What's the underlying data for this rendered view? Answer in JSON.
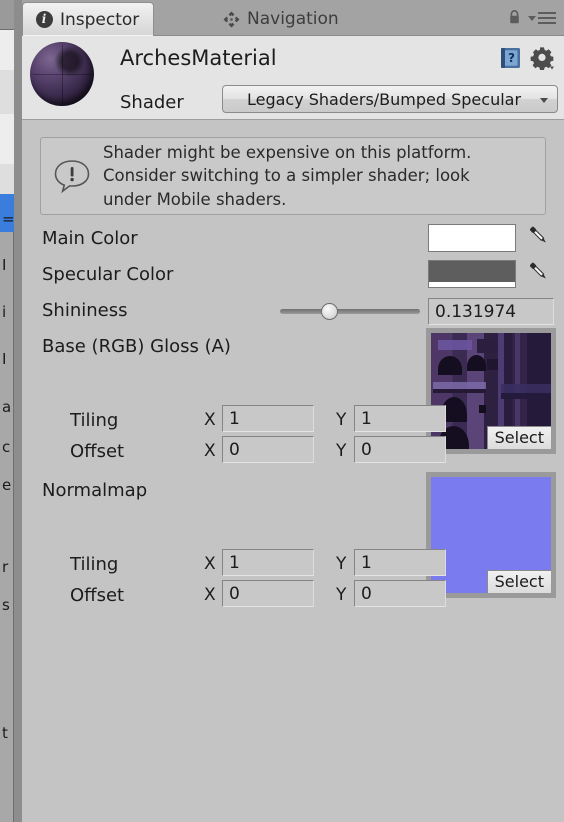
{
  "window": {
    "tabs": [
      {
        "label": "Inspector",
        "icon": "info-circle-icon",
        "active": true
      },
      {
        "label": "Navigation",
        "icon": "move-arrows-icon",
        "active": false
      }
    ],
    "lock_icon": "lock-icon",
    "menu_icon": "hamburger-menu-icon"
  },
  "material": {
    "name": "ArchesMaterial",
    "preview_icon": "material-sphere-preview",
    "shader_label": "Shader",
    "shader_value": "Legacy Shaders/Bumped Specular",
    "help_icon": "help-book-icon",
    "gear_icon": "gear-icon"
  },
  "warning": {
    "icon": "warning-exclamation-icon",
    "text": "Shader might be expensive on this platform.\nConsider switching to a simpler shader; look\nunder Mobile shaders."
  },
  "properties": {
    "main_color": {
      "label": "Main Color",
      "value": "#FFFFFF",
      "alpha": "#FFFFFF",
      "picker_icon": "eyedropper-icon"
    },
    "specular_color": {
      "label": "Specular Color",
      "value": "#5E5E5E",
      "alpha": "#FFFFFF",
      "picker_icon": "eyedropper-icon"
    },
    "shininess": {
      "label": "Shininess",
      "value": "0.131974",
      "slider_percent": 35
    }
  },
  "textures": [
    {
      "label": "Base (RGB) Gloss (A)",
      "preview_kind": "arches-texture",
      "select_label": "Select",
      "tiling": {
        "label": "Tiling",
        "x_label": "X",
        "x": "1",
        "y_label": "Y",
        "y": "1"
      },
      "offset": {
        "label": "Offset",
        "x_label": "X",
        "x": "0",
        "y_label": "Y",
        "y": "0"
      }
    },
    {
      "label": "Normalmap",
      "preview_kind": "normalmap-texture",
      "preview_color": "#7B7BF0",
      "select_label": "Select",
      "tiling": {
        "label": "Tiling",
        "x_label": "X",
        "x": "1",
        "y_label": "Y",
        "y": "1"
      },
      "offset": {
        "label": "Offset",
        "x_label": "X",
        "x": "0",
        "y_label": "Y",
        "y": "0"
      }
    }
  ],
  "left_panel": {
    "fragments": [
      "=",
      "I",
      "i",
      "I",
      "a",
      "c",
      "e",
      "r",
      "s",
      "t"
    ]
  }
}
